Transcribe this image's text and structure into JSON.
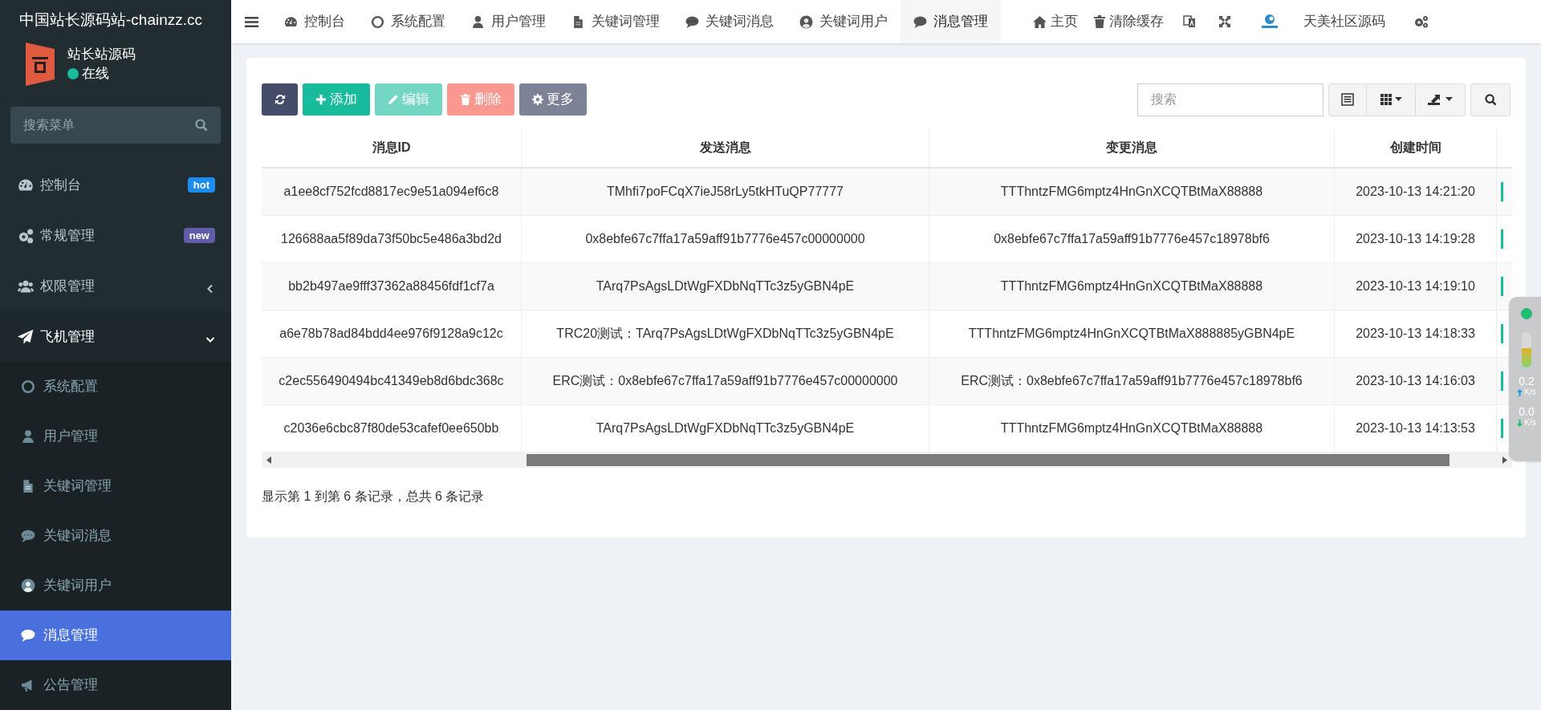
{
  "sidebar": {
    "site_title": "中国站长源码站-chainzz.cc",
    "user": {
      "name": "站长站源码",
      "status": "在线"
    },
    "search_placeholder": "搜索菜单",
    "menu": [
      {
        "label": "控制台",
        "badge": "hot",
        "color": "#1c8cf0",
        "selected": false
      },
      {
        "label": "常规管理",
        "badge": "new",
        "color": "#605ca8",
        "selected": false
      },
      {
        "label": "权限管理",
        "expanded": false,
        "selected": false
      },
      {
        "label": "飞机管理",
        "expanded": true,
        "selected": false,
        "children": [
          {
            "label": "系统配置",
            "selected": false
          },
          {
            "label": "用户管理",
            "selected": false
          },
          {
            "label": "关键词管理",
            "selected": false
          },
          {
            "label": "关键词消息",
            "selected": false
          },
          {
            "label": "关键词用户",
            "selected": false
          },
          {
            "label": "消息管理",
            "selected": true
          },
          {
            "label": "公告管理",
            "selected": false
          }
        ]
      }
    ]
  },
  "top_nav": {
    "tabs": [
      {
        "label": "控制台",
        "selected": false
      },
      {
        "label": "系统配置",
        "selected": false
      },
      {
        "label": "用户管理",
        "selected": false
      },
      {
        "label": "关键词管理",
        "selected": false
      },
      {
        "label": "关键词消息",
        "selected": false
      },
      {
        "label": "关键词用户",
        "selected": false
      },
      {
        "label": "消息管理",
        "selected": true
      }
    ],
    "home": "主页",
    "clear_cache": "清除缓存",
    "community": "天美社区源码"
  },
  "toolbar": {
    "buttons": [
      {
        "kind": "refresh",
        "disabled": false
      },
      {
        "kind": "add",
        "label": "添加",
        "disabled": false
      },
      {
        "kind": "edit",
        "label": "编辑",
        "disabled": true
      },
      {
        "kind": "delete",
        "label": "删除",
        "disabled": true
      },
      {
        "kind": "more",
        "label": "更多",
        "disabled": false
      }
    ],
    "search_placeholder": "搜索"
  },
  "table": {
    "columns": [
      "消息ID",
      "发送消息",
      "变更消息",
      "创建时间"
    ],
    "rows": [
      [
        "a1ee8cf752fcd8817ec9e51a094ef6c8",
        "TMhfi7poFCqX7ieJ58rLy5tkHTuQP77777",
        "TTThntzFMG6mptz4HnGnXCQTBtMaX88888",
        "2023-10-13 14:21:20"
      ],
      [
        "126688aa5f89da73f50bc5e486a3bd2d",
        "0x8ebfe67c7ffa17a59aff91b7776e457c00000000",
        "0x8ebfe67c7ffa17a59aff91b7776e457c18978bf6",
        "2023-10-13 14:19:28"
      ],
      [
        "bb2b497ae9fff37362a88456fdf1cf7a",
        "TArq7PsAgsLDtWgFXDbNqTTc3z5yGBN4pE",
        "TTThntzFMG6mptz4HnGnXCQTBtMaX88888",
        "2023-10-13 14:19:10"
      ],
      [
        "a6e78b78ad84bdd4ee976f9128a9c12c",
        "TRC20测试：TArq7PsAgsLDtWgFXDbNqTTc3z5yGBN4pE",
        "TTThntzFMG6mptz4HnGnXCQTBtMaX888885yGBN4pE",
        "2023-10-13 14:18:33"
      ],
      [
        "c2ec556490494bc41349eb8d6bdc368c",
        "ERC测试：0x8ebfe67c7ffa17a59aff91b7776e457c00000000",
        "ERC测试：0x8ebfe67c7ffa17a59aff91b7776e457c18978bf6",
        "2023-10-13 14:16:03"
      ],
      [
        "c2036e6cbc87f80de53cafef0ee650bb",
        "TArq7PsAgsLDtWgFXDbNqTTc3z5yGBN4pE",
        "TTThntzFMG6mptz4HnGnXCQTBtMaX88888",
        "2023-10-13 14:13:53"
      ]
    ],
    "footer": "显示第 1 到第 6 条记录，总共 6 条记录"
  },
  "speed_monitor": {
    "rates": [
      {
        "kind": "up",
        "value": "0.2",
        "unit": "K/s"
      },
      {
        "kind": "down",
        "value": "0.0",
        "unit": "K/s"
      }
    ]
  }
}
